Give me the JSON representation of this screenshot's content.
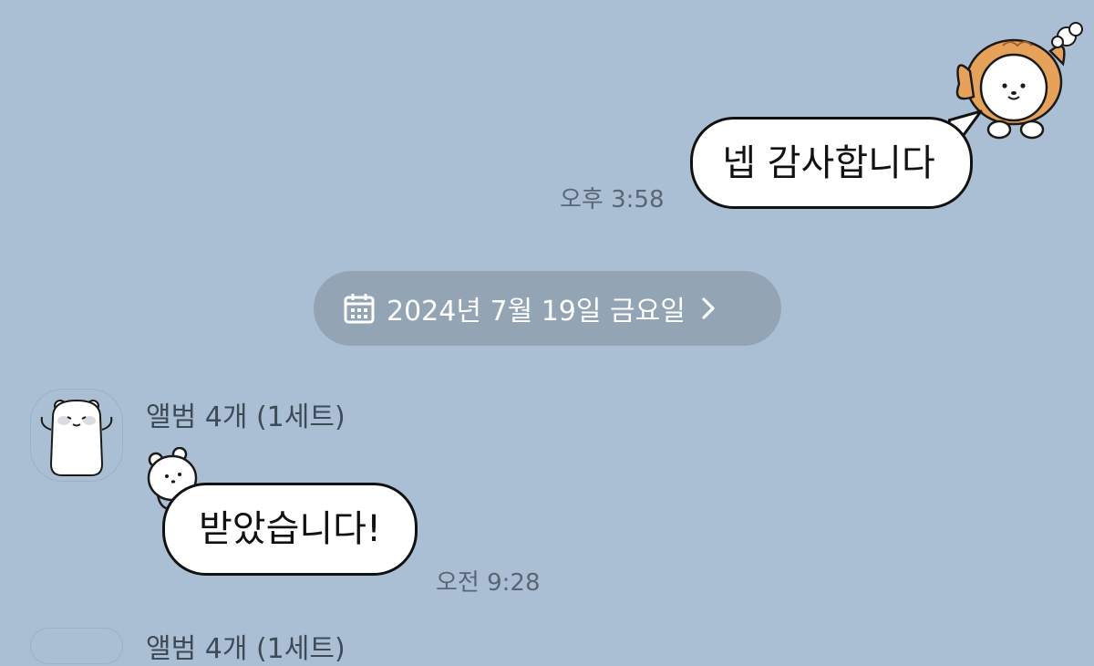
{
  "outgoing": {
    "message": "넵 감사합니다",
    "time": "오후 3:58",
    "sticker_icon": "taiyaki-bear-sticker-icon"
  },
  "date_divider": {
    "label": "2024년 7월 19일 금요일",
    "icon": "calendar-icon",
    "chevron_icon": "chevron-right-icon"
  },
  "incoming": {
    "sender_name": "앨범 4개 (1세트)",
    "avatar_icon": "bear-avatar-icon",
    "message": "받았습니다!",
    "time": "오전 9:28",
    "sticker_icon": "bear-peek-sticker-icon"
  },
  "next_incoming": {
    "sender_name": "앨범 4개 (1세트)"
  },
  "colors": {
    "background": "#abbfd4",
    "bubble": "#ffffff",
    "bubble_border": "#111111",
    "date_pill": "#93a4b5",
    "time_text": "#5a6674"
  }
}
